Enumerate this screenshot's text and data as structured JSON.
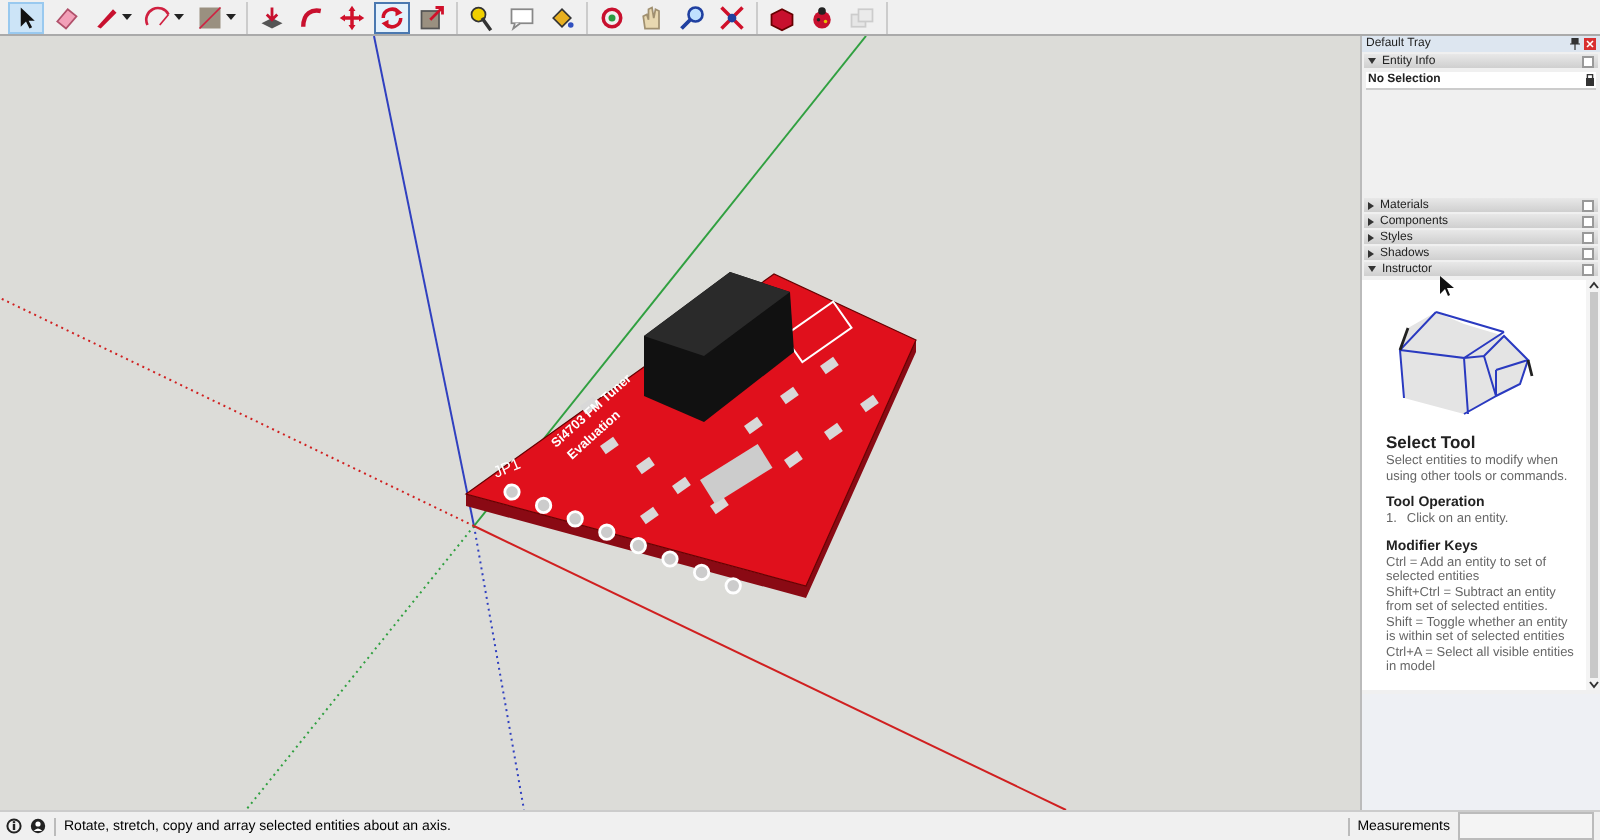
{
  "toolbar": {
    "groups": [
      [
        {
          "kind": "select",
          "selected": true,
          "hovered": false,
          "dropdown": false,
          "disabled": false
        },
        {
          "kind": "eraser",
          "selected": false,
          "hovered": false,
          "dropdown": false,
          "disabled": false
        },
        {
          "kind": "pencil",
          "selected": false,
          "hovered": false,
          "dropdown": true,
          "disabled": false
        },
        {
          "kind": "arc",
          "selected": false,
          "hovered": false,
          "dropdown": true,
          "disabled": false
        },
        {
          "kind": "rectangle",
          "selected": false,
          "hovered": false,
          "dropdown": true,
          "disabled": false
        }
      ],
      [
        {
          "kind": "pushpull",
          "selected": false,
          "hovered": false,
          "dropdown": false,
          "disabled": false
        },
        {
          "kind": "followme",
          "selected": false,
          "hovered": false,
          "dropdown": false,
          "disabled": false
        },
        {
          "kind": "move",
          "selected": false,
          "hovered": false,
          "dropdown": false,
          "disabled": false
        },
        {
          "kind": "rotate",
          "selected": false,
          "hovered": true,
          "dropdown": false,
          "disabled": false
        },
        {
          "kind": "scale",
          "selected": false,
          "hovered": false,
          "dropdown": false,
          "disabled": false
        }
      ],
      [
        {
          "kind": "tape",
          "selected": false,
          "hovered": false,
          "dropdown": false,
          "disabled": false
        },
        {
          "kind": "text",
          "selected": false,
          "hovered": false,
          "dropdown": false,
          "disabled": false
        },
        {
          "kind": "paint",
          "selected": false,
          "hovered": false,
          "dropdown": false,
          "disabled": false
        }
      ],
      [
        {
          "kind": "orbit",
          "selected": false,
          "hovered": false,
          "dropdown": false,
          "disabled": false
        },
        {
          "kind": "pan",
          "selected": false,
          "hovered": false,
          "dropdown": false,
          "disabled": false
        },
        {
          "kind": "zoom",
          "selected": false,
          "hovered": false,
          "dropdown": false,
          "disabled": false
        },
        {
          "kind": "zoomextents",
          "selected": false,
          "hovered": false,
          "dropdown": false,
          "disabled": false
        }
      ],
      [
        {
          "kind": "warehouse",
          "selected": false,
          "hovered": false,
          "dropdown": false,
          "disabled": false
        },
        {
          "kind": "extension",
          "selected": false,
          "hovered": false,
          "dropdown": false,
          "disabled": false
        },
        {
          "kind": "manager",
          "selected": false,
          "hovered": false,
          "dropdown": false,
          "disabled": true
        }
      ]
    ]
  },
  "viewport": {
    "board_label_lines": [
      "Si4703 FM Tuner",
      "Evaluation"
    ],
    "connector_label": "JP1"
  },
  "tray": {
    "title": "Default Tray",
    "panels": [
      {
        "kind": "entity_info",
        "title": "Entity Info",
        "expanded": true,
        "status": "No Selection"
      },
      {
        "kind": "plain",
        "title": "Materials",
        "expanded": false
      },
      {
        "kind": "plain",
        "title": "Components",
        "expanded": false
      },
      {
        "kind": "plain",
        "title": "Styles",
        "expanded": false
      },
      {
        "kind": "plain",
        "title": "Shadows",
        "expanded": false
      },
      {
        "kind": "instructor",
        "title": "Instructor",
        "expanded": true,
        "tool_title": "Select Tool",
        "description": "Select entities to modify when using other tools or commands.",
        "sections": [
          {
            "heading": "Tool Operation",
            "steps": [
              {
                "number": "1.",
                "text": "Click on an entity."
              }
            ]
          },
          {
            "heading": "Modifier Keys",
            "lines": [
              "Ctrl = Add an entity to set of selected entities",
              "Shift+Ctrl = Subtract an entity from set of selected entities.",
              "Shift = Toggle whether an entity is within set of selected entities",
              "Ctrl+A = Select all visible entities in model"
            ]
          }
        ]
      }
    ]
  },
  "status_bar": {
    "message": "Rotate, stretch, copy and array selected entities about an axis.",
    "measurements_label": "Measurements"
  }
}
